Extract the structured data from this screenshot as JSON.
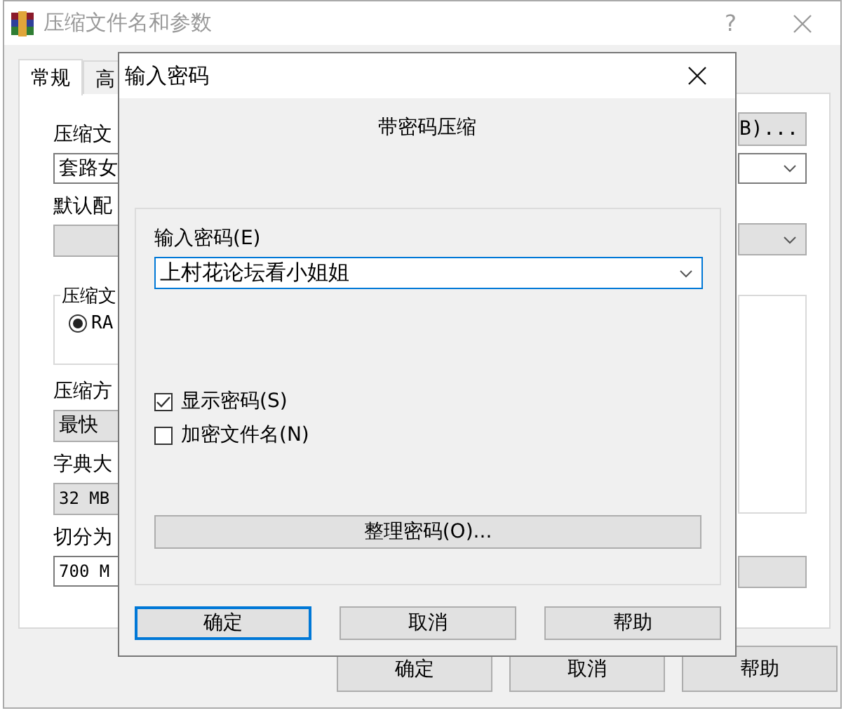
{
  "main_window": {
    "title": "压缩文件名和参数",
    "help_glyph": "?",
    "tabs": [
      {
        "label": "常规",
        "selected": true
      },
      {
        "label": "高",
        "selected": false
      }
    ],
    "left_column": [
      {
        "kind": "label",
        "text": "压缩文"
      },
      {
        "kind": "input",
        "value": "套路女"
      },
      {
        "kind": "label",
        "text": "默认配"
      },
      {
        "kind": "combo"
      },
      {
        "kind": "group",
        "title": "压缩文",
        "radio": {
          "label": "RA",
          "selected": true
        }
      },
      {
        "kind": "label",
        "text": "压缩方"
      },
      {
        "kind": "combo",
        "value": "最快"
      },
      {
        "kind": "label",
        "text": "字典大"
      },
      {
        "kind": "combo",
        "value": "32 MB",
        "mono": true
      },
      {
        "kind": "label",
        "text": "切分为"
      },
      {
        "kind": "input",
        "value": "700 M",
        "mono": true
      }
    ],
    "right_column": [
      {
        "kind": "button",
        "label": "B)..."
      },
      {
        "kind": "dropdown",
        "disabled": false
      },
      {
        "kind": "dropdown",
        "disabled": true
      },
      {
        "kind": "listbox"
      },
      {
        "kind": "button"
      }
    ],
    "buttons": [
      "确定",
      "取消",
      "帮助"
    ]
  },
  "password_dialog": {
    "title": "输入密码",
    "heading": "带密码压缩",
    "field_label": "输入密码(E)",
    "password": "上村花论坛看小姐姐",
    "checkboxes": [
      {
        "label": "显示密码(S)",
        "checked": true
      },
      {
        "label": "加密文件名(N)",
        "checked": false
      }
    ],
    "organize_button": "整理密码(O)...",
    "buttons": [
      {
        "label": "确定",
        "default": true
      },
      {
        "label": "取消",
        "default": false
      },
      {
        "label": "帮助",
        "default": false
      }
    ]
  }
}
